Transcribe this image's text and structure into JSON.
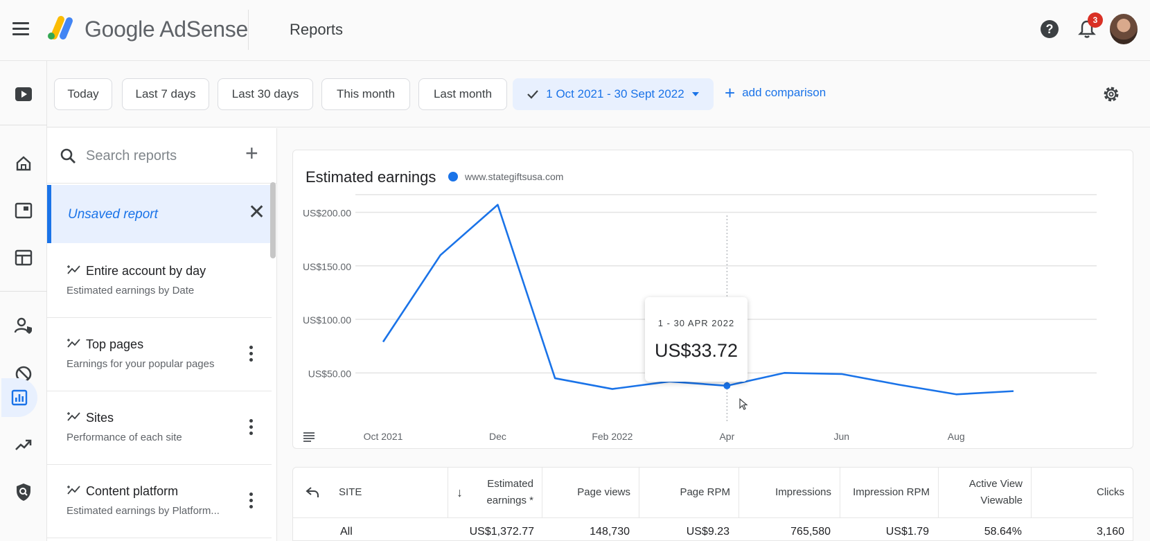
{
  "header": {
    "brand": "Google AdSense",
    "page_title": "Reports",
    "notification_count": "3"
  },
  "filters": {
    "chips": [
      "Today",
      "Last 7 days",
      "Last 30 days",
      "This month",
      "Last month"
    ],
    "date_range": "1 Oct 2021 - 30 Sept 2022",
    "add_comparison": "add comparison"
  },
  "sidebar": {
    "search_placeholder": "Search reports",
    "unsaved": "Unsaved report",
    "reports": [
      {
        "title": "Entire account by day",
        "subtitle": "Estimated earnings by Date"
      },
      {
        "title": "Top pages",
        "subtitle": "Earnings for your popular pages"
      },
      {
        "title": "Sites",
        "subtitle": "Performance of each site"
      },
      {
        "title": "Content platform",
        "subtitle": "Estimated earnings by Platform..."
      }
    ]
  },
  "chart": {
    "title": "Estimated earnings",
    "legend": "www.stategiftsusa.com",
    "tooltip": {
      "date": "1 - 30 APR 2022",
      "value": "US$33.72"
    }
  },
  "chart_data": {
    "type": "line",
    "title": "Estimated earnings",
    "x": [
      "Oct 2021",
      "Nov 2021",
      "Dec 2021",
      "Jan 2022",
      "Feb 2022",
      "Mar 2022",
      "Apr 2022",
      "May 2022",
      "Jun 2022",
      "Jul 2022",
      "Aug 2022",
      "Sep 2022"
    ],
    "x_tick_labels": [
      "Oct 2021",
      "Dec",
      "Feb 2022",
      "Apr",
      "Jun",
      "Aug"
    ],
    "y_tick_labels": [
      "US$200.00",
      "US$150.00",
      "US$100.00",
      "US$50.00"
    ],
    "ylim": [
      25,
      210
    ],
    "series": [
      {
        "name": "www.stategiftsusa.com",
        "values": [
          79,
          160,
          207,
          45,
          35,
          42,
          38,
          50,
          49,
          39,
          30,
          33
        ]
      }
    ],
    "grid": true,
    "color": "#1a73e8"
  },
  "table": {
    "headers": [
      "SITE",
      "Estimated earnings *",
      "Page views",
      "Page RPM",
      "Impressions",
      "Impression RPM",
      "Active View Viewable",
      "Clicks"
    ],
    "row": [
      "All",
      "US$1,372.77",
      "148,730",
      "US$9.23",
      "765,580",
      "US$1.79",
      "58.64%",
      "3,160"
    ]
  },
  "colors": {
    "accent": "#1a73e8",
    "selected_bg": "#e8f0fe",
    "badge": "#d93025"
  }
}
